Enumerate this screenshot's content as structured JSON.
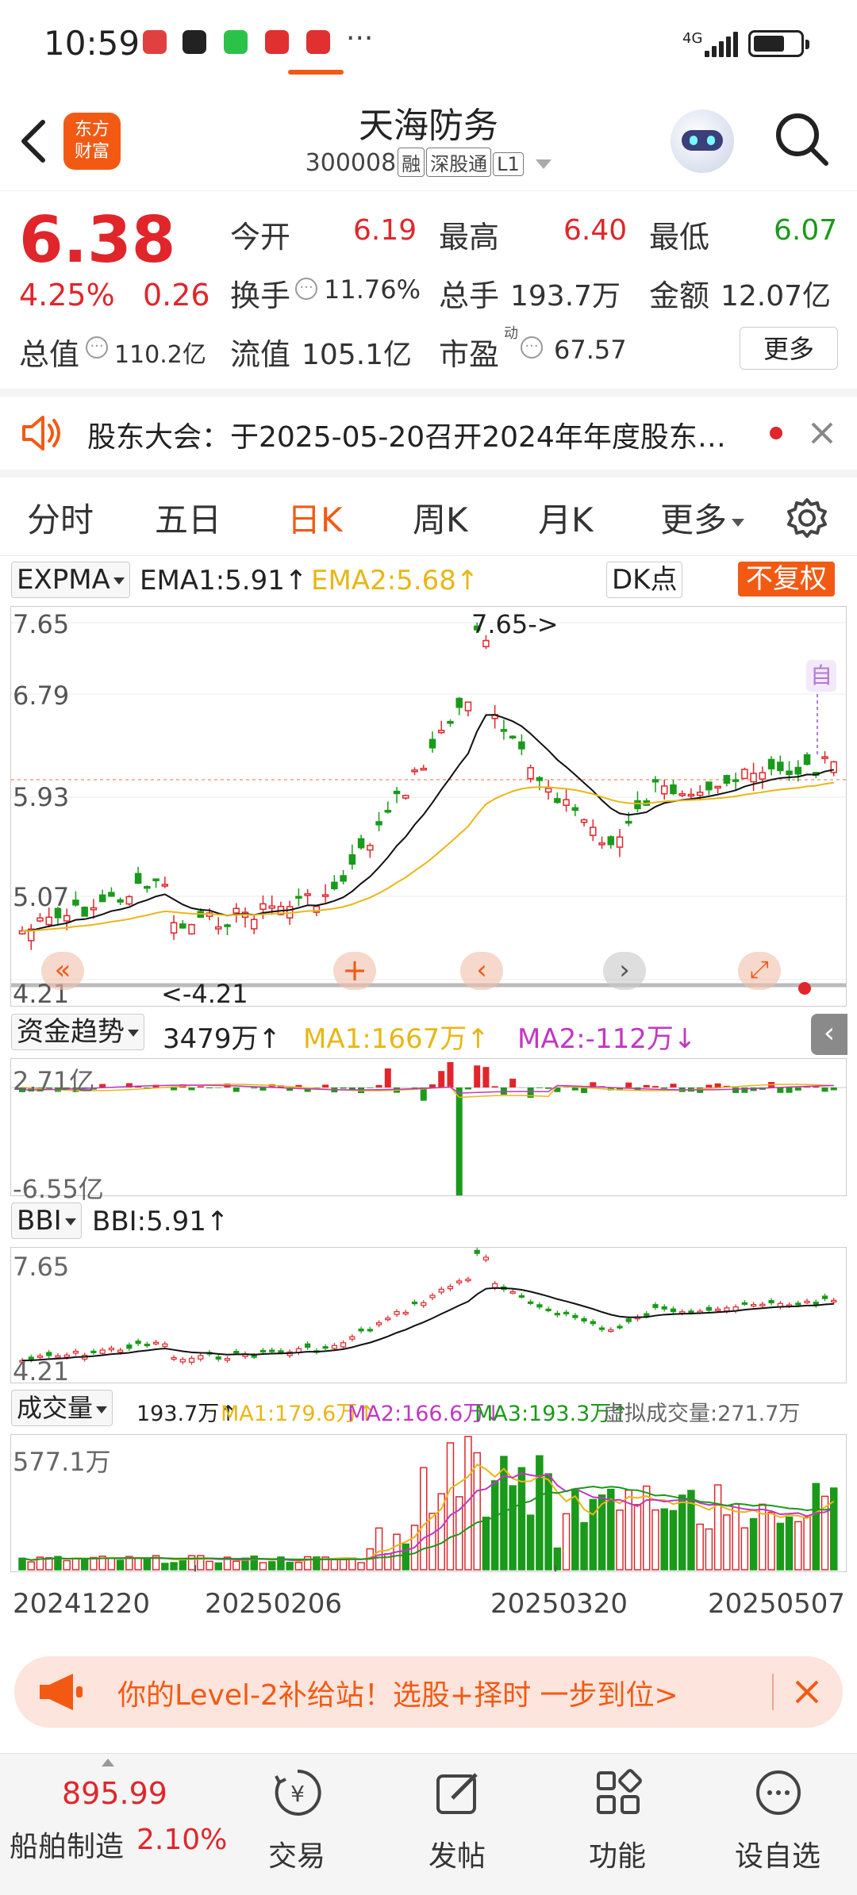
{
  "status_bar": {
    "time": "10:59",
    "more": "···",
    "network": "4G"
  },
  "header": {
    "logo_line1": "东方",
    "logo_line2": "财富",
    "title": "天海防务",
    "code": "300008",
    "tags": [
      "融",
      "深股通",
      "L1"
    ]
  },
  "quote": {
    "price": "6.38",
    "change_pct": "4.25%",
    "change": "0.26",
    "open_label": "今开",
    "open": "6.19",
    "high_label": "最高",
    "high": "6.40",
    "low_label": "最低",
    "low": "6.07",
    "turnover_label": "换手",
    "turnover": "11.76%",
    "volume_label": "总手",
    "volume": "193.7万",
    "amount_label": "金额",
    "amount": "12.07亿",
    "mcap_label": "总值",
    "mcap": "110.2亿",
    "float_label": "流值",
    "float": "105.1亿",
    "pe_label": "市盈",
    "pe_sup": "动",
    "pe": "67.57",
    "more": "更多",
    "colors": {
      "up": "#e0262b",
      "down": "#1a9a1a"
    }
  },
  "notice": {
    "text": "股东大会：于2025-05-20召开2024年年度股东…"
  },
  "tabs": [
    {
      "label": "分时"
    },
    {
      "label": "五日"
    },
    {
      "label": "日K"
    },
    {
      "label": "周K"
    },
    {
      "label": "月K"
    },
    {
      "label": "更多"
    }
  ],
  "kline": {
    "indicator": "EXPMA",
    "ema1": "EMA1:5.91",
    "ema2": "EMA2:5.68",
    "dk": "DK点",
    "fq": "不复权",
    "y_labels": [
      "7.65",
      "6.79",
      "5.93",
      "5.07",
      "4.21"
    ],
    "max_annot": "7.65->",
    "min_annot": "<-4.21",
    "self_tag": "自",
    "arrow": "↑"
  },
  "capital": {
    "indicator": "资金趋势",
    "value": "3479万",
    "ma1": "MA1:1667万",
    "ma2": "MA2:-112万",
    "up": "↑",
    "down": "↓",
    "y_top": "2.71亿",
    "y_bottom": "-6.55亿"
  },
  "bbi": {
    "indicator": "BBI",
    "value": "BBI:5.91",
    "arrow": "↑",
    "y_top": "7.65",
    "y_bottom": "4.21"
  },
  "volume": {
    "indicator": "成交量",
    "value": "193.7万",
    "ma1": "MA1:179.6万",
    "ma2": "MA2:166.6万",
    "ma3": "MA3:193.3万",
    "virtual": "虚拟成交量:271.7万",
    "up": "↑",
    "down": "↓",
    "y_top": "577.1万",
    "dates": [
      "20241220",
      "20250206",
      "20250320",
      "20250507"
    ]
  },
  "banner": {
    "text": "你的Level-2补给站！选股+择时 一步到位>"
  },
  "bottom_nav": {
    "index_value": "895.99",
    "index_name": "船舶制造",
    "index_pct": "2.10%",
    "items": [
      {
        "label": "交易"
      },
      {
        "label": "发帖"
      },
      {
        "label": "功能"
      },
      {
        "label": "设自选"
      }
    ]
  }
}
